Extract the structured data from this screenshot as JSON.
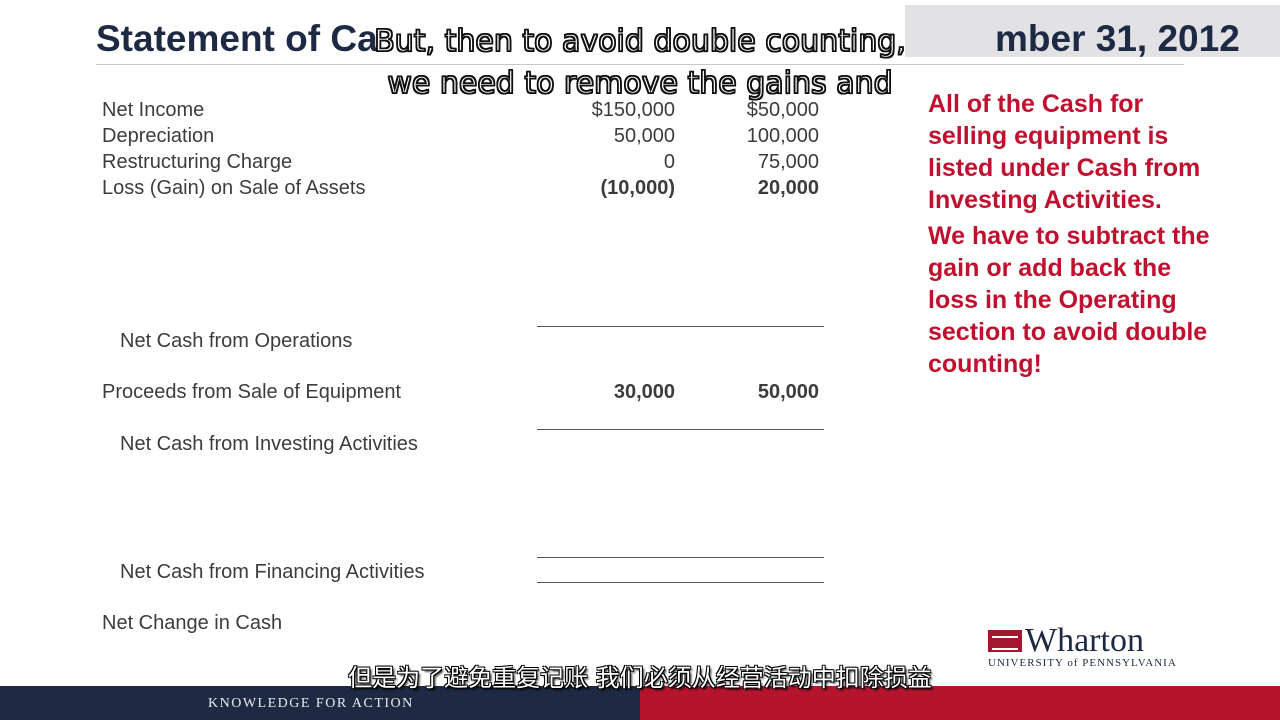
{
  "slide": {
    "title_left": "Statement of Ca",
    "title_right": "mber 31, 2012"
  },
  "rows": [
    {
      "label": "Net Income",
      "v1": "$150,000",
      "v2": "$50,000"
    },
    {
      "label": "Depreciation",
      "v1": "50,000",
      "v2": "100,000"
    },
    {
      "label": "Restructuring Charge",
      "v1": "0",
      "v2": "75,000"
    },
    {
      "label": "Loss (Gain) on Sale of Assets",
      "v1": "(10,000)",
      "v2": "20,000"
    }
  ],
  "sections": {
    "operations": "Net Cash from Operations",
    "proceeds": {
      "label": "Proceeds from Sale of Equipment",
      "v1": "30,000",
      "v2": "50,000"
    },
    "investing": "Net Cash from Investing Activities",
    "financing": "Net Cash from Financing Activities",
    "net_change": "Net Change in Cash"
  },
  "sidebar": {
    "para1": "All of the Cash for selling equipment is listed under Cash from Investing Activities.",
    "para2": "We have to subtract the gain or add back the loss in the Operating section to avoid double counting!"
  },
  "subtitles": {
    "line1": "But, then to avoid double counting,",
    "line2": "we need to remove the gains and",
    "chinese": "但是为了避免重复记账 我们必须从经营活动中扣除损益"
  },
  "logo": {
    "name": "Wharton",
    "university": "UNIVERSITY of PENNSYLVANIA"
  },
  "footer": {
    "tagline": "KNOWLEDGE FOR ACTION"
  },
  "colors": {
    "navy": "#1e2a44",
    "red": "#b4152d",
    "callout_red": "#c0102f"
  }
}
